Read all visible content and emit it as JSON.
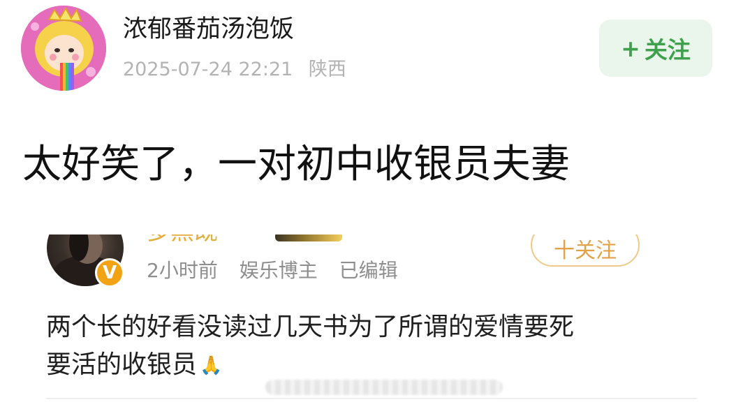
{
  "post": {
    "author": {
      "name": "浓郁番茄汤泡饭",
      "avatar": "cartoon-girl-crown-avatar"
    },
    "meta": {
      "datetime": "2025-07-24 22:21",
      "location": "陕西"
    },
    "follow_button": {
      "icon": "+",
      "label": "关注",
      "accent": "#3fa14e",
      "background": "#eaf6ec"
    },
    "text": "太好笑了，一对初中收银员夫妻"
  },
  "embedded_post": {
    "author_name_cut": "多黑既",
    "verified_badge": "V",
    "follow_label": "十关注",
    "meta": {
      "time": "2小时前",
      "role": "娱乐博主",
      "edited": "已编辑"
    },
    "text_lines": [
      "两个长的好看没读过几天书为了所谓的爱情要死",
      "要活的收银员"
    ],
    "emoji": "🙏",
    "accent": "#f2a313"
  }
}
